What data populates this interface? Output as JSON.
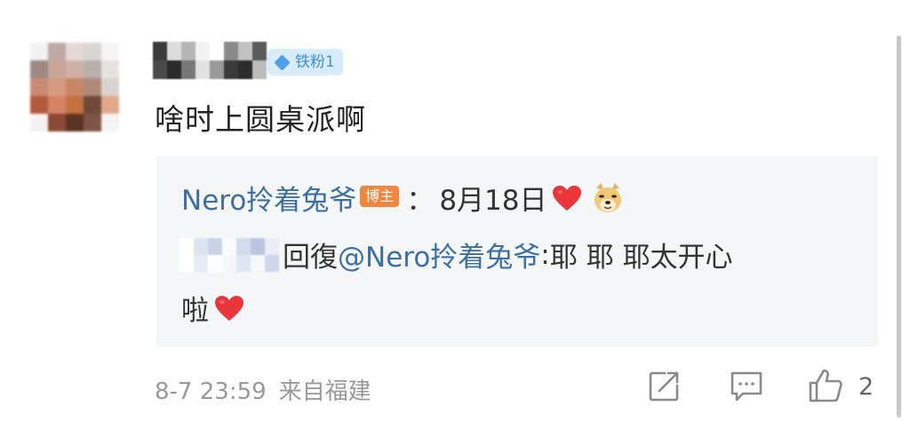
{
  "comment": {
    "fan_badge": "铁粉1",
    "text": "啥时上圆桌派啊"
  },
  "reply": {
    "author": "Nero拎着兔爷",
    "host_badge": "博主",
    "separator": "：",
    "date": "8月18日",
    "reply_word": "回復",
    "mention": "@Nero拎着兔爷",
    "colon": ":",
    "text_part1": "耶 耶 耶太开心",
    "text_part2": "啦"
  },
  "footer": {
    "timestamp": "8-7 23:59",
    "source": "来自福建",
    "like_count": "2"
  },
  "icons": {
    "fan_badge": "diamond-icon",
    "heart": "red-heart-icon",
    "dog": "doge-emoji-icon",
    "forward": "share-icon",
    "comment": "comment-icon",
    "like": "thumbs-up-icon"
  },
  "colors": {
    "link": "#3d6fa5",
    "host_badge": "#f4863b",
    "fan_badge_bg": "#d9ecfb",
    "heart": "#e8363a",
    "muted": "#999999"
  }
}
